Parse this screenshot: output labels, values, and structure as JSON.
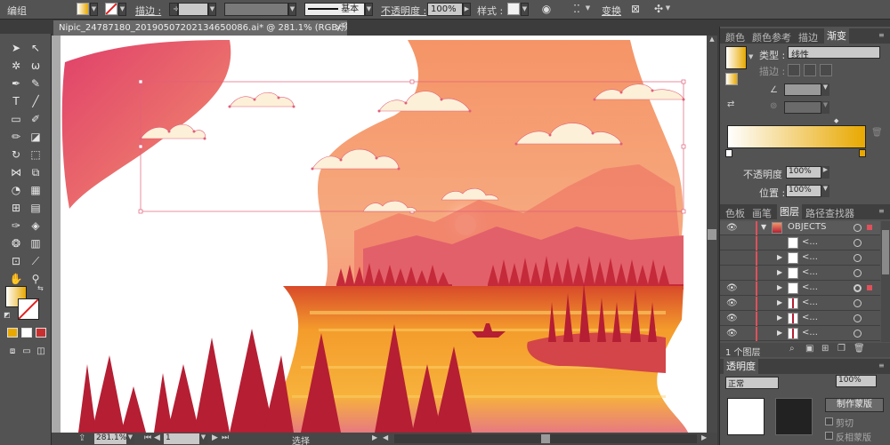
{
  "menu": {
    "group_label": "编组"
  },
  "control_bar": {
    "stroke_label": "描边 :",
    "stroke_style": "基本",
    "opacity_label": "不透明度 :",
    "opacity_value": "100%",
    "style_label": "样式 :",
    "transform_label": "变换"
  },
  "document": {
    "tab_title": "Nipic_24787180_20190507202134650086.ai* @ 281.1% (RGB/预览)",
    "close": "×"
  },
  "status": {
    "zoom": "281.1%",
    "page": "1",
    "tool": "选择"
  },
  "panels": {
    "top_tabs": [
      "颜色",
      "颜色参考",
      "描边",
      "渐变"
    ],
    "gradient": {
      "type_label": "类型 :",
      "type_value": "线性",
      "stroke_label": "描边 :",
      "opacity_label": "不透明度 :",
      "opacity_value": "100%",
      "location_label": "位置 :",
      "location_value": "100%"
    },
    "mid_tabs": [
      "色板",
      "画笔",
      "图层",
      "路径查找器"
    ],
    "layers": {
      "group_name": "OBJECTS",
      "item_name": "<...",
      "count_label": "1 个图层"
    },
    "bottom_tabs": [
      "透明度"
    ],
    "transparency": {
      "mode_label": "正常",
      "opacity_value": "100%",
      "make_mask_button": "制作蒙版",
      "clip_label": "剪切",
      "invert_label": "反相蒙版"
    }
  },
  "colors": {
    "gradient_start": "#ffffff",
    "gradient_end": "#e8a800",
    "sky_top": "#f4956b",
    "sky_bottom": "#f7b48f",
    "lake": "#f29a2a",
    "tree": "#b51e33",
    "accent_orange": "#ff8a3a"
  }
}
